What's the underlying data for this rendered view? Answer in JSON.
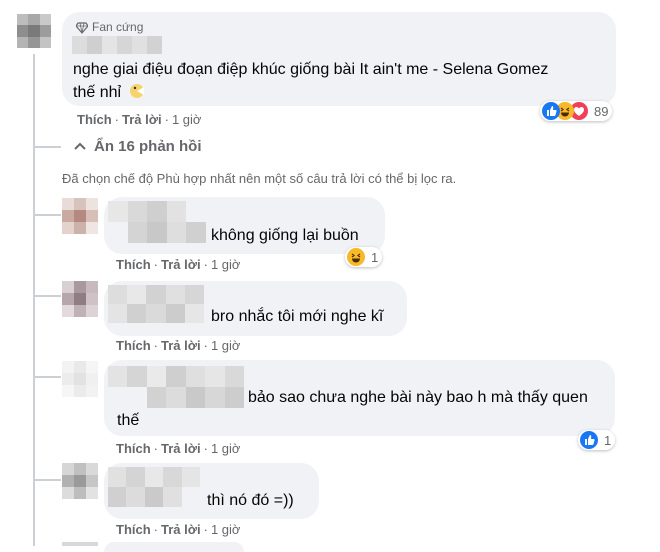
{
  "main_comment": {
    "badge_label": "Fan cứng",
    "text_line1": "nghe giai điệu đoạn điệp khúc giống bài It ain't me - Selena Gomez",
    "text_line2": "thế nhỉ",
    "reaction_count": "89",
    "actions": {
      "like": "Thích",
      "reply": "Trả lời",
      "time": "1 giờ"
    }
  },
  "toggle_replies": {
    "label": "Ẩn 16 phản hồi"
  },
  "filter_note": "Đã chọn chế độ Phù hợp nhất nên một số câu trả lời có thể bị lọc ra.",
  "replies": [
    {
      "text": "không giống lại buồn",
      "reaction_count": "1",
      "actions": {
        "like": "Thích",
        "reply": "Trả lời",
        "time": "1 giờ"
      }
    },
    {
      "text": "bro nhắc tôi mới nghe kĩ",
      "actions": {
        "like": "Thích",
        "reply": "Trả lời",
        "time": "1 giờ"
      }
    },
    {
      "text_line1": "bảo sao chưa nghe bài này bao h mà thấy quen",
      "text_line2": "thế",
      "reaction_count": "1",
      "actions": {
        "like": "Thích",
        "reply": "Trả lời",
        "time": "1 giờ"
      }
    },
    {
      "text": "thì nó đó =))",
      "actions": {
        "like": "Thích",
        "reply": "Trả lời",
        "time": "1 giờ"
      }
    }
  ],
  "colors": {
    "bubble": "#f0f2f5",
    "secondary_text": "#65676b",
    "like_blue": "#1877f2",
    "love_red": "#f33e58",
    "haha_yellow": "#f7b928"
  },
  "icons": [
    "diamond-icon",
    "emoji-icon",
    "like-icon",
    "haha-icon",
    "love-icon",
    "chevron-up-icon"
  ]
}
